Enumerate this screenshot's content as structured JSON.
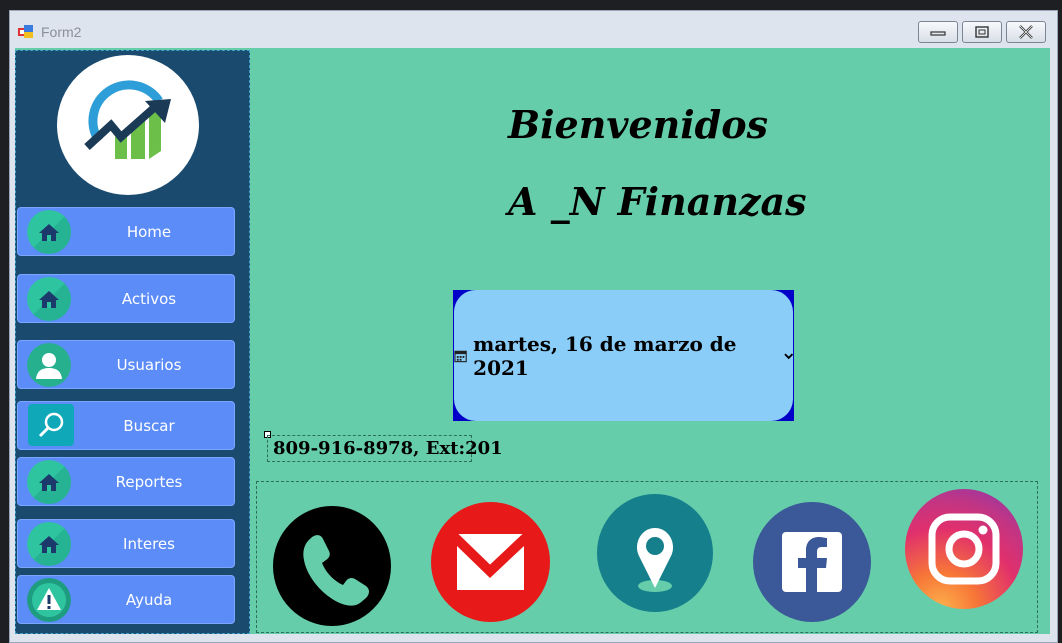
{
  "window": {
    "title": "Form2"
  },
  "sidebar": {
    "logo": "finance-growth-logo",
    "items": [
      {
        "label": "Home",
        "icon": "house-icon"
      },
      {
        "label": "Activos",
        "icon": "house-icon"
      },
      {
        "label": "Usuarios",
        "icon": "user-icon"
      },
      {
        "label": "Buscar",
        "icon": "search-icon"
      },
      {
        "label": "Reportes",
        "icon": "house-icon"
      },
      {
        "label": "Interes",
        "icon": "house-icon"
      },
      {
        "label": "Ayuda",
        "icon": "warning-icon"
      }
    ]
  },
  "main": {
    "welcome": "Bienvenidos",
    "company": "A _N Finanzas",
    "date_picker": {
      "value": "martes, 16 de marzo de 2021"
    },
    "contact_phone": "809-916-8978, Ext:201",
    "social": [
      {
        "name": "phone-icon",
        "color": "#000000"
      },
      {
        "name": "email-icon",
        "color": "#e81919"
      },
      {
        "name": "location-icon",
        "color": "#157f8c"
      },
      {
        "name": "facebook-icon",
        "color": "#3b5998"
      },
      {
        "name": "instagram-icon",
        "color": "#d62976"
      }
    ]
  },
  "colors": {
    "main_bg": "#66cdaa",
    "sidebar_bg": "#1a4a6e",
    "nav_button": "#5c8cf7",
    "date_bg": "#8acdf8"
  }
}
